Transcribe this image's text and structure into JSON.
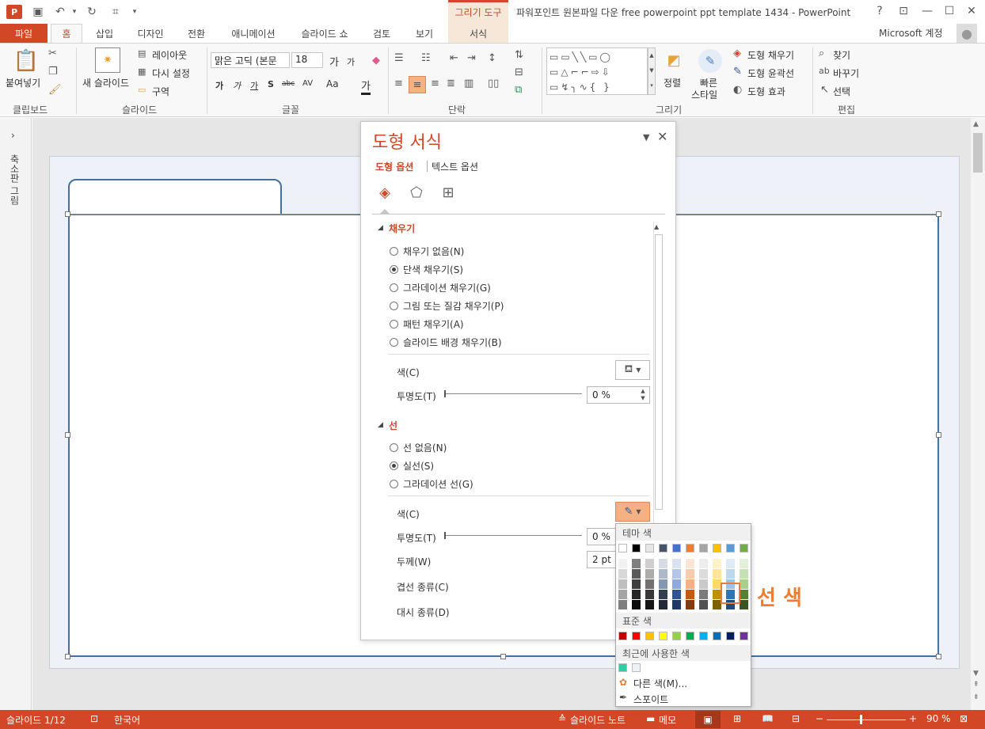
{
  "window": {
    "title": "파워포인트 원본파일 다운 free powerpoint ppt template 1434 - PowerPoint",
    "tool_context": "그리기 도구",
    "account": "Microsoft 계정",
    "app_logo": "P"
  },
  "qat": {
    "save": "▣",
    "undo": "↶",
    "redo": "↻",
    "present": "⌗",
    "more": "▾"
  },
  "window_buttons": {
    "help": "?",
    "restore_ribbon": "⊡",
    "minimize": "—",
    "maximize": "☐",
    "close": "✕"
  },
  "tabs": [
    "파일",
    "홈",
    "삽입",
    "디자인",
    "전환",
    "애니메이션",
    "슬라이드 쇼",
    "검토",
    "보기",
    "서식"
  ],
  "ribbon": {
    "clipboard": {
      "paste": "붙여넣기",
      "group": "클립보드"
    },
    "slides": {
      "new_slide": "새 슬라이드",
      "layout": "레이아웃",
      "reset": "다시 설정",
      "section": "구역",
      "group": "슬라이드"
    },
    "font": {
      "font_name": "맑은 고딕 (본문",
      "font_size": "18",
      "grow": "가",
      "shrink": "가",
      "bold": "가",
      "italic": "가",
      "underline": "가",
      "shadow": "S",
      "strike": "abc",
      "spacing": "AV",
      "case": "Aa",
      "color": "가",
      "group": "글꼴"
    },
    "paragraph": {
      "group": "단락"
    },
    "drawing": {
      "arrange": "정렬",
      "quick_styles_1": "빠른",
      "quick_styles_2": "스타일",
      "shape_fill": "도형 채우기",
      "shape_outline": "도형 윤곽선",
      "shape_effects": "도형 효과",
      "group": "그리기"
    },
    "editing": {
      "find": "찾기",
      "replace": "바꾸기",
      "select": "선택",
      "group": "편집"
    }
  },
  "thumb_pane": {
    "label": "축소판 그림"
  },
  "format_pane": {
    "title": "도형 서식",
    "tab_shape": "도형 옵션",
    "tab_text": "텍스트 옵션",
    "fill": {
      "header": "채우기",
      "options": [
        "채우기 없음(N)",
        "단색 채우기(S)",
        "그라데이션 채우기(G)",
        "그림 또는 질감 채우기(P)",
        "패턴 채우기(A)",
        "슬라이드 배경 채우기(B)"
      ],
      "selected_index": 1,
      "color_label": "색(C)",
      "transparency_label": "투명도(T)",
      "transparency_value": "0 %"
    },
    "line": {
      "header": "선",
      "options": [
        "선 없음(N)",
        "실선(S)",
        "그라데이션 선(G)"
      ],
      "selected_index": 1,
      "color_label": "색(C)",
      "transparency_label": "투명도(T)",
      "transparency_value": "0 %",
      "width_label": "두께(W)",
      "width_value": "2 pt",
      "compound_label": "겹선 종류(C)",
      "dash_label": "대시 종류(D)"
    }
  },
  "color_picker": {
    "theme_header": "테마 색",
    "standard_header": "표준 색",
    "recent_header": "최근에 사용한 색",
    "more_colors": "다른 색(M)...",
    "eyedropper": "스포이트",
    "theme_top": [
      "#ffffff",
      "#000000",
      "#e7e6e6",
      "#44546a",
      "#4472c4",
      "#ed7d31",
      "#a5a5a5",
      "#ffc000",
      "#5b9bd5",
      "#70ad47"
    ],
    "theme_shades": [
      [
        "#f2f2f2",
        "#7f7f7f",
        "#d0cece",
        "#d6dce4",
        "#d9e2f3",
        "#fbe5d5",
        "#ededed",
        "#fff2cc",
        "#deebf6",
        "#e2efd9"
      ],
      [
        "#d8d8d8",
        "#595959",
        "#aeabab",
        "#adb9ca",
        "#b4c6e7",
        "#f7cbac",
        "#dbdbdb",
        "#fee599",
        "#bdd7ee",
        "#c5e0b3"
      ],
      [
        "#bfbfbf",
        "#3f3f3f",
        "#757070",
        "#8496b0",
        "#8eaadb",
        "#f4b183",
        "#c9c9c9",
        "#ffd965",
        "#9cc3e5",
        "#a8d08d"
      ],
      [
        "#a5a5a5",
        "#262626",
        "#3a3838",
        "#323f4f",
        "#2f5496",
        "#c55a11",
        "#7b7b7b",
        "#bf9000",
        "#2e75b5",
        "#538135"
      ],
      [
        "#7f7f7f",
        "#0c0c0c",
        "#171616",
        "#222a35",
        "#1f3864",
        "#833c0b",
        "#525252",
        "#7f6000",
        "#1e4e79",
        "#375623"
      ]
    ],
    "standard": [
      "#c00000",
      "#ff0000",
      "#ffc000",
      "#ffff00",
      "#92d050",
      "#00b050",
      "#00b0f0",
      "#0070c0",
      "#002060",
      "#7030a0"
    ],
    "recent": [
      "#2ecfa8",
      "#eef1f8"
    ]
  },
  "annotation": "선 색",
  "status": {
    "slide": "슬라이드 1/12",
    "language": "한국어",
    "notes": "슬라이드 노트",
    "comments": "메모",
    "zoom": "90 %"
  },
  "colors": {
    "accent": "#d24726",
    "shape_outline": "#41719c",
    "annotation": "#ee7d31"
  }
}
